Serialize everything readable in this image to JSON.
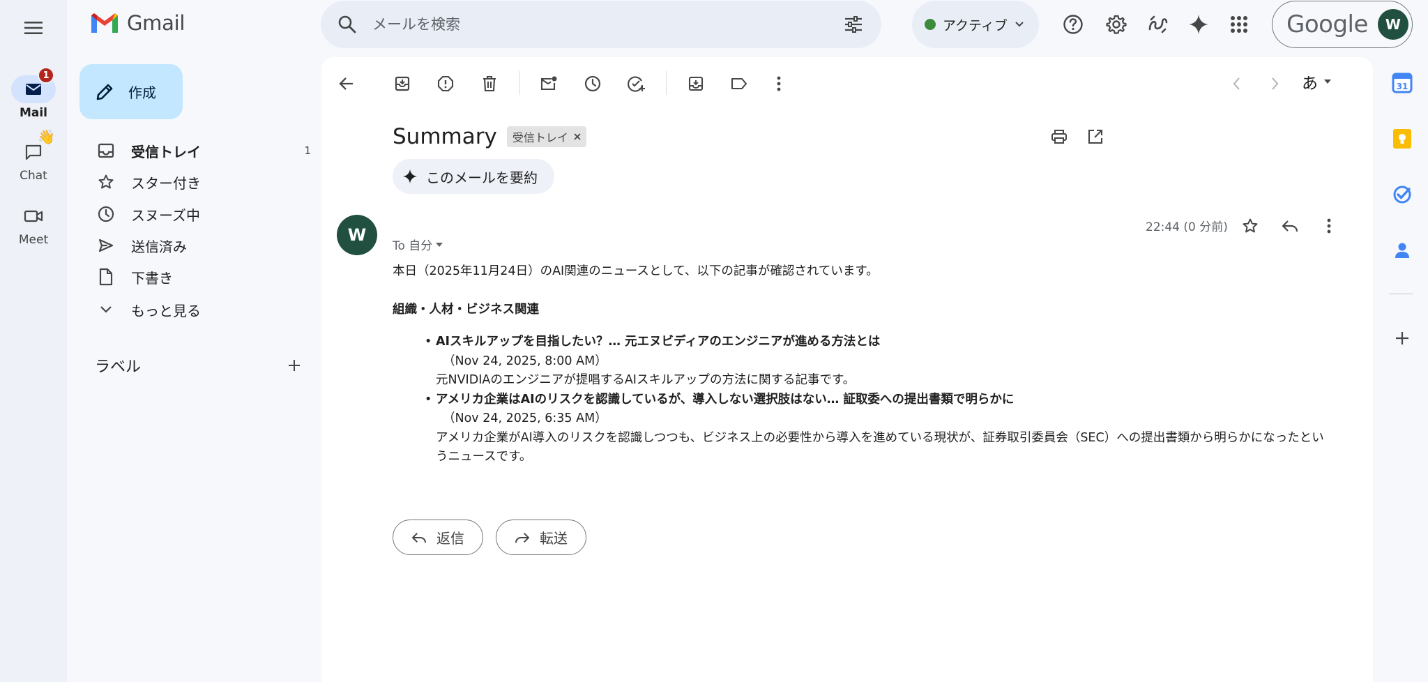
{
  "app": {
    "name": "Gmail"
  },
  "rail": {
    "items": [
      {
        "label": "Mail",
        "badge": "1",
        "icon": "mail-icon"
      },
      {
        "label": "Chat",
        "emoji": "👋",
        "icon": "chat-icon"
      },
      {
        "label": "Meet",
        "icon": "video-icon"
      }
    ]
  },
  "search": {
    "placeholder": "メールを検索"
  },
  "status": {
    "label": "アクティブ",
    "color": "#3c8a3c"
  },
  "account": {
    "brand": "Google",
    "initial": "W"
  },
  "compose": {
    "label": "作成"
  },
  "nav": [
    {
      "label": "受信トレイ",
      "count": "1",
      "icon": "inbox-icon"
    },
    {
      "label": "スター付き",
      "icon": "star-icon"
    },
    {
      "label": "スヌーズ中",
      "icon": "clock-icon"
    },
    {
      "label": "送信済み",
      "icon": "send-icon"
    },
    {
      "label": "下書き",
      "icon": "draft-icon"
    },
    {
      "label": "もっと見る",
      "icon": "chevron-down-icon"
    }
  ],
  "labels": {
    "title": "ラベル"
  },
  "toolbar": {
    "ime": "あ"
  },
  "email": {
    "subject": "Summary",
    "label_chip": "受信トレイ",
    "summarize": "このメールを要約",
    "sender_initial": "W",
    "time": "22:44 (0 分前)",
    "to": "To 自分",
    "intro": "本日（2025年11月24日）のAI関連のニュースとして、以下の記事が確認されています。",
    "section_heading": "組織・人材・ビジネス関連",
    "articles": [
      {
        "title": "AIスキルアップを目指したい？… 元エヌビディアのエンジニアが進める方法とは",
        "date": "（Nov 24, 2025, 8:00 AM）",
        "desc": "元NVIDIAのエンジニアが提唱するAIスキルアップの方法に関する記事です。"
      },
      {
        "title": "アメリカ企業はAIのリスクを認識しているが、導入しない選択肢はない… 証取委への提出書類で明らかに",
        "date": "（Nov 24, 2025, 6:35 AM）",
        "desc": "アメリカ企業がAI導入のリスクを認識しつつも、ビジネス上の必要性から導入を進めている現状が、証券取引委員会（SEC）への提出書類から明らかになったというニュースです。"
      }
    ],
    "reply_label": "返信",
    "forward_label": "転送"
  },
  "colors": {
    "accent": "#0b57d0",
    "compose_bg": "#c2e7ff",
    "active_rail": "#d3e3fd",
    "avatar": "#215040",
    "badge": "#b3261e"
  }
}
